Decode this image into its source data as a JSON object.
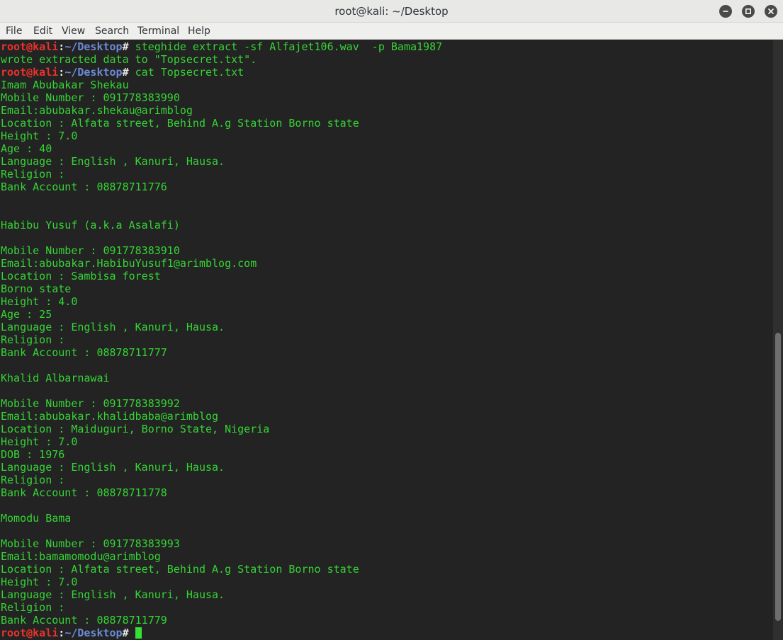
{
  "window": {
    "title": "root@kali: ~/Desktop"
  },
  "menu": {
    "items": [
      "File",
      "Edit",
      "View",
      "Search",
      "Terminal",
      "Help"
    ]
  },
  "prompt": {
    "user": "root@kali",
    "sep": ":",
    "path": "~/Desktop",
    "hash": "#"
  },
  "terminal": {
    "lines": [
      {
        "type": "prompt",
        "cmd": " steghide extract -sf Alfajet106.wav  -p Bama1987"
      },
      {
        "type": "out",
        "text": "wrote extracted data to \"Topsecret.txt\"."
      },
      {
        "type": "prompt",
        "cmd": " cat Topsecret.txt"
      },
      {
        "type": "out",
        "text": "Imam Abubakar Shekau"
      },
      {
        "type": "out",
        "text": "Mobile Number : 091778383990"
      },
      {
        "type": "out",
        "text": "Email:abubakar.shekau@arimblog"
      },
      {
        "type": "out",
        "text": "Location : Alfata street, Behind A.g Station Borno state"
      },
      {
        "type": "out",
        "text": "Height : 7.0"
      },
      {
        "type": "out",
        "text": "Age : 40"
      },
      {
        "type": "out",
        "text": "Language : English , Kanuri, Hausa."
      },
      {
        "type": "out",
        "text": "Religion :"
      },
      {
        "type": "out",
        "text": "Bank Account : 08878711776"
      },
      {
        "type": "out",
        "text": ""
      },
      {
        "type": "out",
        "text": ""
      },
      {
        "type": "out",
        "text": "Habibu Yusuf (a.k.a Asalafi)"
      },
      {
        "type": "out",
        "text": ""
      },
      {
        "type": "out",
        "text": "Mobile Number : 091778383910"
      },
      {
        "type": "out",
        "text": "Email:abubakar.HabibuYusuf1@arimblog.com"
      },
      {
        "type": "out",
        "text": "Location : Sambisa forest"
      },
      {
        "type": "out",
        "text": "Borno state"
      },
      {
        "type": "out",
        "text": "Height : 4.0"
      },
      {
        "type": "out",
        "text": "Age : 25"
      },
      {
        "type": "out",
        "text": "Language : English , Kanuri, Hausa."
      },
      {
        "type": "out",
        "text": "Religion :"
      },
      {
        "type": "out",
        "text": "Bank Account : 08878711777"
      },
      {
        "type": "out",
        "text": ""
      },
      {
        "type": "out",
        "text": "Khalid Albarnawai"
      },
      {
        "type": "out",
        "text": ""
      },
      {
        "type": "out",
        "text": "Mobile Number : 091778383992"
      },
      {
        "type": "out",
        "text": "Email:abubakar.khalidbaba@arimblog"
      },
      {
        "type": "out",
        "text": "Location : Maiduguri, Borno State, Nigeria"
      },
      {
        "type": "out",
        "text": "Height : 7.0"
      },
      {
        "type": "out",
        "text": "DOB : 1976"
      },
      {
        "type": "out",
        "text": "Language : English , Kanuri, Hausa."
      },
      {
        "type": "out",
        "text": "Religion :"
      },
      {
        "type": "out",
        "text": "Bank Account : 08878711778"
      },
      {
        "type": "out",
        "text": ""
      },
      {
        "type": "out",
        "text": "Momodu Bama"
      },
      {
        "type": "out",
        "text": ""
      },
      {
        "type": "out",
        "text": "Mobile Number : 091778383993"
      },
      {
        "type": "out",
        "text": "Email:bamamomodu@arimblog"
      },
      {
        "type": "out",
        "text": "Location : Alfata street, Behind A.g Station Borno state"
      },
      {
        "type": "out",
        "text": "Height : 7.0"
      },
      {
        "type": "out",
        "text": "Language : English , Kanuri, Hausa."
      },
      {
        "type": "out",
        "text": "Religion :"
      },
      {
        "type": "out",
        "text": "Bank Account : 08878711779"
      },
      {
        "type": "prompt",
        "cmd": " ",
        "cursor": true
      }
    ]
  },
  "scrollbar": {
    "position_fraction": 0.5,
    "visible_fraction": 0.48
  },
  "colors": {
    "prompt_user": "#e8332c",
    "prompt_path": "#6b8bd6",
    "output_text": "#35d435",
    "background": "#232323"
  },
  "icons": {
    "minimize": "minimize-icon",
    "maximize": "maximize-icon",
    "close": "close-icon"
  }
}
